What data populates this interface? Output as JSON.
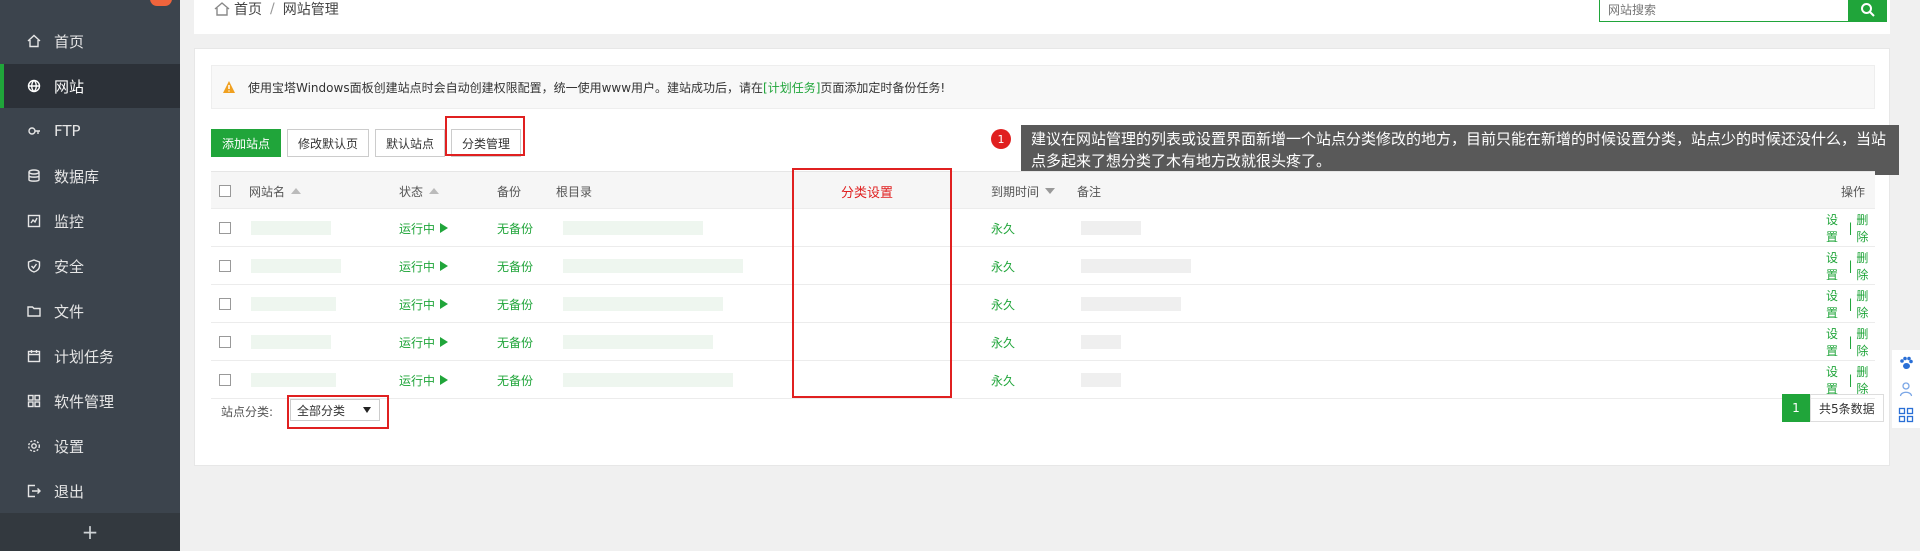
{
  "sidebar": {
    "items": [
      {
        "label": "首页",
        "icon": "home-icon"
      },
      {
        "label": "网站",
        "icon": "globe-icon"
      },
      {
        "label": "FTP",
        "icon": "ftp-icon"
      },
      {
        "label": "数据库",
        "icon": "database-icon"
      },
      {
        "label": "监控",
        "icon": "monitor-icon"
      },
      {
        "label": "安全",
        "icon": "shield-icon"
      },
      {
        "label": "文件",
        "icon": "folder-icon"
      },
      {
        "label": "计划任务",
        "icon": "calendar-icon"
      },
      {
        "label": "软件管理",
        "icon": "grid-icon"
      },
      {
        "label": "设置",
        "icon": "gear-icon"
      },
      {
        "label": "退出",
        "icon": "logout-icon"
      }
    ],
    "active_index": 1,
    "add_label": "+"
  },
  "breadcrumb": {
    "home": "首页",
    "sep": "/",
    "current": "网站管理"
  },
  "search": {
    "placeholder": "网站搜索"
  },
  "notice": {
    "prefix": "使用宝塔Windows面板创建站点时会自动创建权限配置，统一使用www用户。建站成功后，请在",
    "link": "[计划任务]",
    "suffix": "页面添加定时备份任务!"
  },
  "buttons": {
    "add": "添加站点",
    "modify_default": "修改默认页",
    "default_site": "默认站点",
    "category_manage": "分类管理"
  },
  "annotation": {
    "badge": "1",
    "text": "建议在网站管理的列表或设置界面新增一个站点分类修改的地方，目前只能在新增的时候设置分类，站点少的时候还没什么，当站点多起来了想分类了木有地方改就很头疼了。",
    "column_label": "分类设置"
  },
  "table": {
    "headers": {
      "name": "网站名",
      "status": "状态",
      "backup": "备份",
      "root": "根目录",
      "expire": "到期时间",
      "remark": "备注",
      "actions": "操作"
    },
    "rows": [
      {
        "status": "运行中",
        "backup": "无备份",
        "expire": "永久",
        "settings": "设置",
        "sep": "|",
        "delete": "删除"
      },
      {
        "status": "运行中",
        "backup": "无备份",
        "expire": "永久",
        "settings": "设置",
        "sep": "|",
        "delete": "删除"
      },
      {
        "status": "运行中",
        "backup": "无备份",
        "expire": "永久",
        "settings": "设置",
        "sep": "|",
        "delete": "删除"
      },
      {
        "status": "运行中",
        "backup": "无备份",
        "expire": "永久",
        "settings": "设置",
        "sep": "|",
        "delete": "删除"
      },
      {
        "status": "运行中",
        "backup": "无备份",
        "expire": "永久",
        "settings": "设置",
        "sep": "|",
        "delete": "删除"
      }
    ]
  },
  "footer": {
    "category_label": "站点分类:",
    "category_value": "全部分类",
    "page": "1",
    "total": "共5条数据"
  },
  "colors": {
    "accent": "#20a53a",
    "highlight": "#e02020",
    "sidebar": "#3c444d"
  }
}
